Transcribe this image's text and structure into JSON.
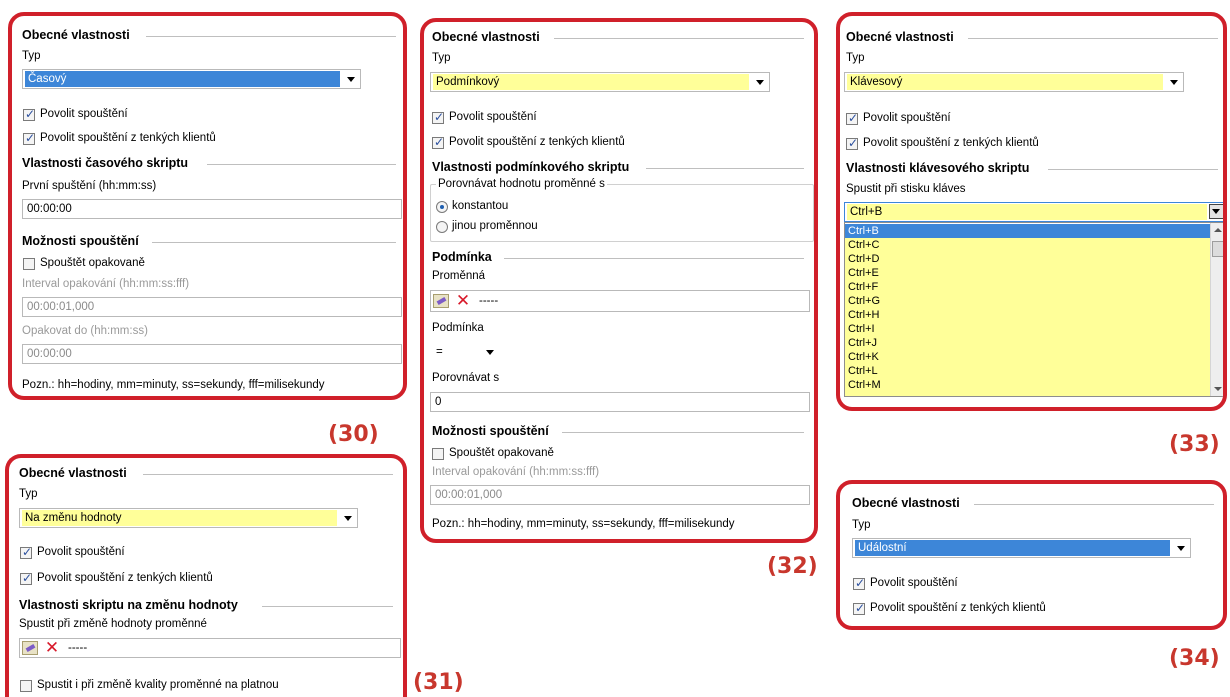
{
  "p30": {
    "general_title": "Obecné vlastnosti",
    "type_label": "Typ",
    "type_value": "Časový",
    "enable_run": "Povolit spouštění",
    "enable_thin": "Povolit spouštění z tenkých klientů",
    "props_title": "Vlastnosti časového skriptu",
    "first_run_label": "První spuštění (hh:mm:ss)",
    "first_run_value": "00:00:00",
    "run_opts_title": "Možnosti spouštění",
    "repeat_label": "Spouštět opakovaně",
    "interval_label": "Interval opakování (hh:mm:ss:fff)",
    "interval_value": "00:00:01,000",
    "until_label": "Opakovat do (hh:mm:ss)",
    "until_value": "00:00:00",
    "note": "Pozn.: hh=hodiny, mm=minuty, ss=sekundy, fff=milisekundy",
    "tag": "(30)"
  },
  "p31": {
    "general_title": "Obecné vlastnosti",
    "type_label": "Typ",
    "type_value": "Na změnu hodnoty",
    "enable_run": "Povolit spouštění",
    "enable_thin": "Povolit spouštění z tenkých klientů",
    "props_title": "Vlastnosti skriptu na změnu hodnoty",
    "trigger_label": "Spustit při změně hodnoty proměnné",
    "var_value": "-----",
    "quality_label": "Spustit i při změně kvality proměnné na platnou",
    "tag": "(31)"
  },
  "p32": {
    "general_title": "Obecné vlastnosti",
    "type_label": "Typ",
    "type_value": "Podmínkový",
    "enable_run": "Povolit spouštění",
    "enable_thin": "Povolit spouštění z tenkých klientů",
    "props_title": "Vlastnosti podmínkového skriptu",
    "compare_group": "Porovnávat hodnotu proměnné s",
    "opt_const": "konstantou",
    "opt_other": "jinou proměnnou",
    "cond_title": "Podmínka",
    "var_label": "Proměnná",
    "var_value": "-----",
    "cond_label": "Podmínka",
    "cond_value": "=",
    "compare_label": "Porovnávat s",
    "compare_value": "0",
    "run_opts_title": "Možnosti spouštění",
    "repeat_label": "Spouštět opakovaně",
    "interval_label": "Interval opakování (hh:mm:ss:fff)",
    "interval_value": "00:00:01,000",
    "note": "Pozn.: hh=hodiny, mm=minuty, ss=sekundy, fff=milisekundy",
    "tag": "(32)"
  },
  "p33": {
    "general_title": "Obecné vlastnosti",
    "type_label": "Typ",
    "type_value": "Klávesový",
    "enable_run": "Povolit spouštění",
    "enable_thin": "Povolit spouštění z tenkých klientů",
    "props_title": "Vlastnosti klávesového skriptu",
    "keys_label": "Spustit při stisku kláves",
    "keys_value": "Ctrl+B",
    "keys_options": [
      "Ctrl+B",
      "Ctrl+C",
      "Ctrl+D",
      "Ctrl+E",
      "Ctrl+F",
      "Ctrl+G",
      "Ctrl+H",
      "Ctrl+I",
      "Ctrl+J",
      "Ctrl+K",
      "Ctrl+L",
      "Ctrl+M"
    ],
    "tag": "(33)"
  },
  "p34": {
    "general_title": "Obecné vlastnosti",
    "type_label": "Typ",
    "type_value": "Událostní",
    "enable_run": "Povolit spouštění",
    "enable_thin": "Povolit spouštění z tenkých klientů",
    "tag": "(34)"
  },
  "colors": {
    "frame": "#d0202a",
    "tag": "#c8372d",
    "yellow": "#ffff99",
    "selection": "#3d86d8"
  }
}
